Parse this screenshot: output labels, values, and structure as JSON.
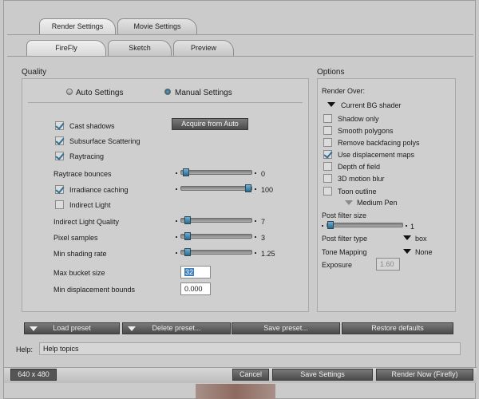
{
  "top_tabs": [
    "Render Settings",
    "Movie Settings"
  ],
  "sub_tabs": [
    "FireFly",
    "Sketch",
    "Preview"
  ],
  "quality": {
    "title": "Quality",
    "auto_label": "Auto Settings",
    "manual_label": "Manual Settings",
    "selected": "manual",
    "acquire_button": "Acquire from Auto",
    "checkboxes": [
      {
        "label": "Cast shadows",
        "checked": true
      },
      {
        "label": "Subsurface Scattering",
        "checked": true
      },
      {
        "label": "Raytracing",
        "checked": true
      }
    ],
    "raytrace_bounces": {
      "label": "Raytrace bounces",
      "value": "0",
      "fraction": 0.02
    },
    "irradiance": {
      "label": "Irradiance caching",
      "checked": true,
      "value": "100",
      "fraction": 1.0
    },
    "indirect_light": {
      "label": "Indirect Light",
      "checked": false
    },
    "indirect_quality": {
      "label": "Indirect Light Quality",
      "value": "7",
      "fraction": 0.05
    },
    "pixel_samples": {
      "label": "Pixel samples",
      "value": "3",
      "fraction": 0.05
    },
    "min_shading": {
      "label": "Min shading rate",
      "value": "1.25",
      "fraction": 0.05
    },
    "max_bucket": {
      "label": "Max bucket size",
      "value": "32"
    },
    "min_displacement": {
      "label": "Min displacement bounds",
      "value": "0.000"
    }
  },
  "options": {
    "title": "Options",
    "render_over_label": "Render Over:",
    "render_over_value": "Current BG shader",
    "checkboxes": [
      {
        "label": "Shadow only",
        "checked": false
      },
      {
        "label": "Smooth polygons",
        "checked": false
      },
      {
        "label": "Remove backfacing polys",
        "checked": false
      },
      {
        "label": "Use displacement maps",
        "checked": true
      },
      {
        "label": "Depth of field",
        "checked": false
      },
      {
        "label": "3D motion blur",
        "checked": false
      },
      {
        "label": "Toon outline",
        "checked": false
      }
    ],
    "toon_style": "Medium Pen",
    "post_filter_size": {
      "label": "Post filter size",
      "value": "1",
      "fraction": 0.0
    },
    "post_filter_type": {
      "label": "Post filter type",
      "value": "box"
    },
    "tone_mapping": {
      "label": "Tone Mapping",
      "value": "None"
    },
    "exposure": {
      "label": "Exposure",
      "value": "1.60"
    }
  },
  "preset_buttons": [
    "Load preset",
    "Delete preset...",
    "Save preset...",
    "Restore defaults"
  ],
  "help": {
    "label": "Help:",
    "text": "Help topics"
  },
  "bottom": {
    "size": "640 x 480",
    "cancel": "Cancel",
    "save": "Save Settings",
    "render": "Render Now (Firefly)"
  }
}
